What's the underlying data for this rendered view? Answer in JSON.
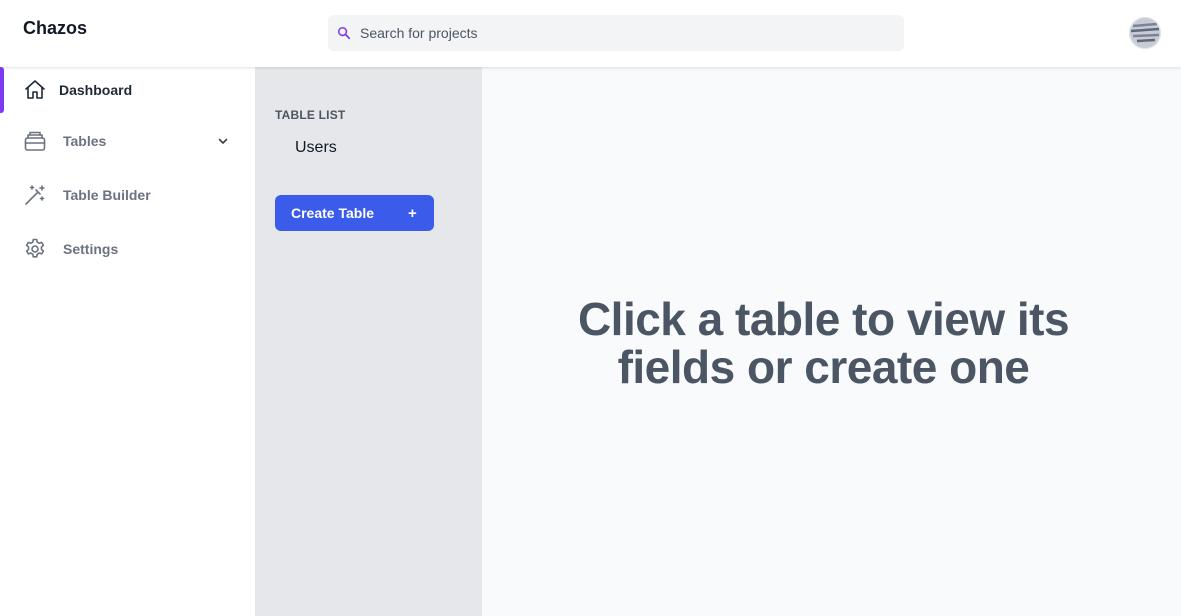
{
  "app": {
    "brand": "Chazos"
  },
  "search": {
    "placeholder": "Search for projects",
    "icon": "search-icon",
    "accent": "#7e3af2"
  },
  "user": {
    "avatar_icon": "avatar"
  },
  "sidebar": {
    "items": [
      {
        "label": "Dashboard",
        "icon": "home-icon",
        "active": true
      },
      {
        "label": "Tables",
        "icon": "tables-icon",
        "expandable": true
      },
      {
        "label": "Table Builder",
        "icon": "magic-wand-icon"
      },
      {
        "label": "Settings",
        "icon": "gear-icon"
      }
    ],
    "active_indicator_color": "#7e3af2"
  },
  "table_list": {
    "title": "TABLE LIST",
    "tables": [
      "Users"
    ],
    "create_button": {
      "label": "Create Table",
      "icon_glyph": "+",
      "color": "#3b5bea"
    }
  },
  "main": {
    "empty_message_line1": "Click a table to view its",
    "empty_message_line2": "fields or create one"
  }
}
